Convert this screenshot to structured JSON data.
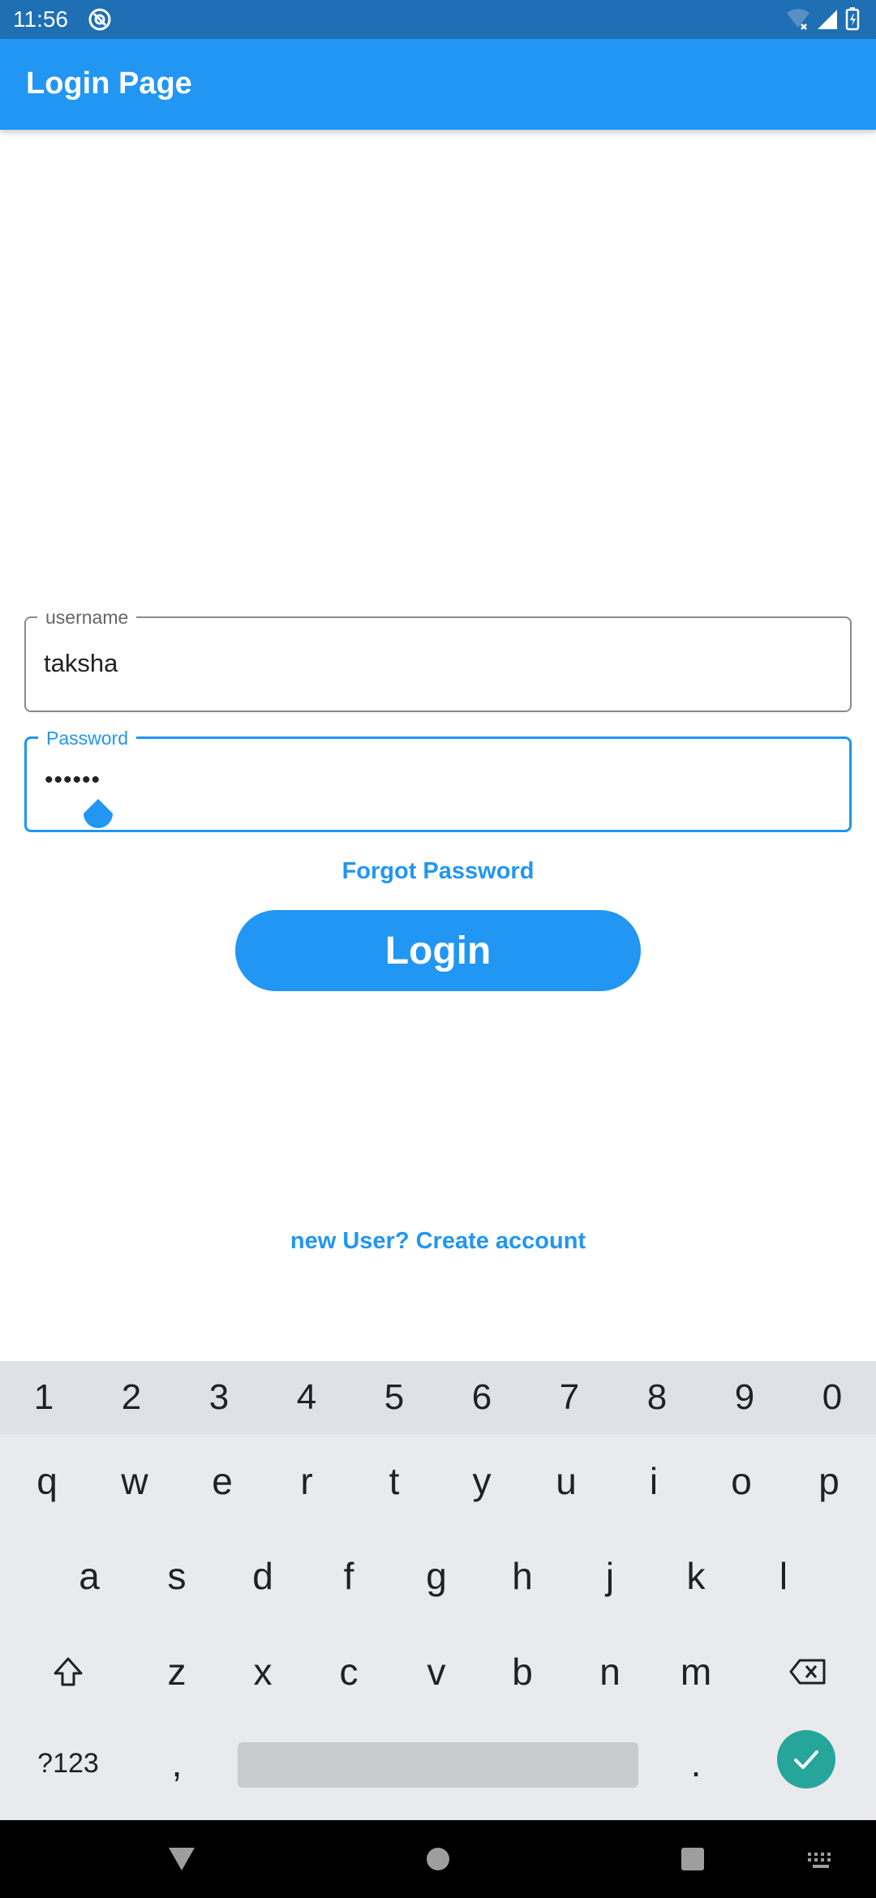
{
  "status_bar": {
    "time": "11:56",
    "icons": [
      "at-sign-icon",
      "wifi-icon",
      "signal-icon",
      "battery-icon"
    ]
  },
  "app_bar": {
    "title": "Login Page",
    "color": "#2196f3"
  },
  "form": {
    "username_label": "username",
    "username_value": "taksha",
    "password_label": "Password",
    "password_value": "••••••",
    "forgot_password": "Forgot Password",
    "login_button": "Login",
    "create_account": "new User? Create account"
  },
  "keyboard": {
    "number_row": [
      "1",
      "2",
      "3",
      "4",
      "5",
      "6",
      "7",
      "8",
      "9",
      "0"
    ],
    "row1": [
      "q",
      "w",
      "e",
      "r",
      "t",
      "y",
      "u",
      "i",
      "o",
      "p"
    ],
    "row2": [
      "a",
      "s",
      "d",
      "f",
      "g",
      "h",
      "j",
      "k",
      "l"
    ],
    "row3": [
      "z",
      "x",
      "c",
      "v",
      "b",
      "n",
      "m"
    ],
    "symbols_key": "?123",
    "comma_key": ",",
    "period_key": ".",
    "accent_color": "#26a69a"
  },
  "nav_bar": {
    "icons": [
      "back-icon",
      "home-icon",
      "recents-icon",
      "keyboard-switch-icon"
    ]
  }
}
